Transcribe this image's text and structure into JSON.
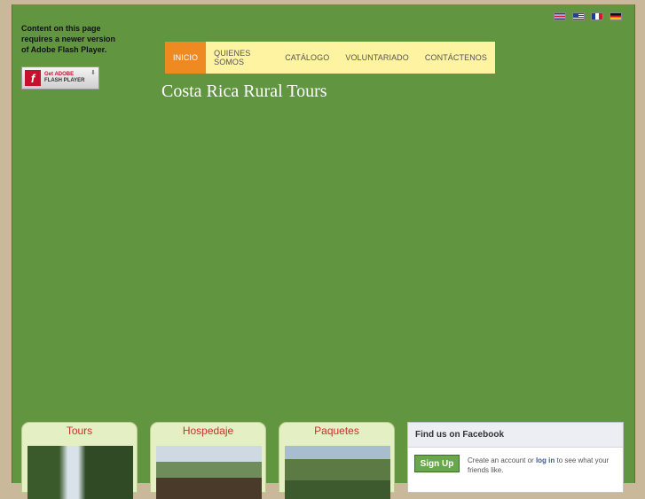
{
  "flash": {
    "message": "Content on this page requires a newer version of Adobe Flash Player.",
    "badge_get": "Get ADOBE",
    "badge_product": "FLASH PLAYER",
    "badge_icon": "flash-f-icon"
  },
  "flags": [
    "costa-rica-flag-icon",
    "usa-flag-icon",
    "france-flag-icon",
    "germany-flag-icon"
  ],
  "nav": {
    "items": [
      "INICIO",
      "QUIENES SOMOS",
      "CATÁLOGO",
      "VOLUNTARIADO",
      "CONTÁCTENOS"
    ],
    "active_index": 0,
    "bar_color": "#fdf3a0",
    "active_color": "#ef8a23"
  },
  "site": {
    "title": "Costa Rica Rural Tours",
    "background_color": "#629540"
  },
  "cards": [
    {
      "title": "Tours"
    },
    {
      "title": "Hospedaje"
    },
    {
      "title": "Paquetes"
    }
  ],
  "facebook": {
    "heading": "Find us on Facebook",
    "signup_label": "Sign Up",
    "text_before": "Create an account or ",
    "login_label": "log in",
    "text_after": " to see what your friends like."
  }
}
